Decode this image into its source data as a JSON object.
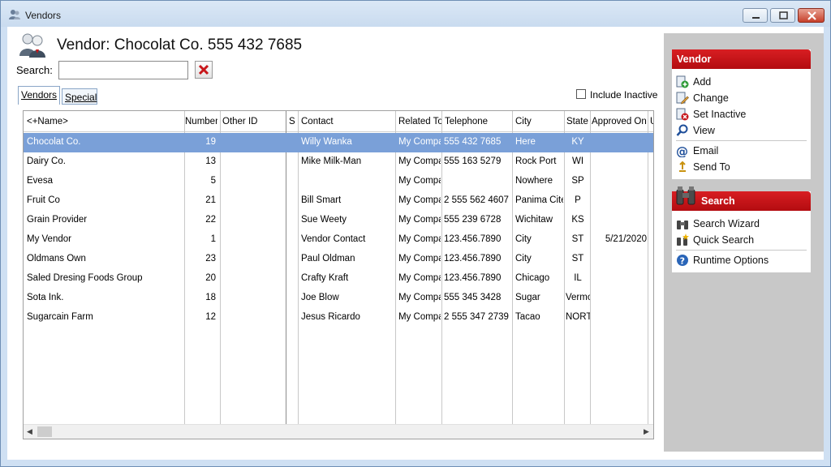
{
  "window": {
    "title": "Vendors"
  },
  "header": {
    "title": "Vendor: Chocolat Co. 555 432 7685"
  },
  "search": {
    "label": "Search:",
    "value": ""
  },
  "tabs": [
    {
      "label": "Vendors"
    },
    {
      "label": "Special"
    }
  ],
  "include_inactive": {
    "label": "Include Inactive",
    "checked": false
  },
  "grid": {
    "columns": [
      "<+Name>",
      "Number",
      "Other ID",
      "S",
      "Contact",
      "Related To",
      "Telephone",
      "City",
      "State",
      "Approved On",
      "U"
    ],
    "rows": [
      {
        "name": "Chocolat Co.",
        "number": "19",
        "other_id": "",
        "s": "",
        "contact": "Willy Wanka",
        "related": "My Company",
        "phone": "555 432 7685",
        "city": "Here",
        "state": "KY",
        "approved": ""
      },
      {
        "name": "Dairy Co.",
        "number": "13",
        "other_id": "",
        "s": "",
        "contact": "Mike Milk-Man",
        "related": "My Company",
        "phone": "555 163 5279",
        "city": "Rock Port",
        "state": "WI",
        "approved": ""
      },
      {
        "name": "Evesa",
        "number": "5",
        "other_id": "",
        "s": "",
        "contact": "",
        "related": "My Company",
        "phone": "",
        "city": "Nowhere",
        "state": "SP",
        "approved": ""
      },
      {
        "name": "Fruit Co",
        "number": "21",
        "other_id": "",
        "s": "",
        "contact": "Bill Smart",
        "related": "My Company",
        "phone": "2 555 562 4607",
        "city": "Panima Cite",
        "state": "P",
        "approved": ""
      },
      {
        "name": "Grain Provider",
        "number": "22",
        "other_id": "",
        "s": "",
        "contact": "Sue Weety",
        "related": "My Company",
        "phone": "555 239 6728",
        "city": "Wichitaw",
        "state": "KS",
        "approved": ""
      },
      {
        "name": "My Vendor",
        "number": "1",
        "other_id": "",
        "s": "",
        "contact": "Vendor Contact",
        "related": "My Company",
        "phone": "123.456.7890",
        "city": "City",
        "state": "ST",
        "approved": "5/21/2020"
      },
      {
        "name": "Oldmans Own",
        "number": "23",
        "other_id": "",
        "s": "",
        "contact": "Paul Oldman",
        "related": "My Company",
        "phone": "123.456.7890",
        "city": "City",
        "state": "ST",
        "approved": ""
      },
      {
        "name": "Saled Dresing Foods Group",
        "number": "20",
        "other_id": "",
        "s": "",
        "contact": "Crafty Kraft",
        "related": "My Company",
        "phone": "123.456.7890",
        "city": "Chicago",
        "state": "IL",
        "approved": ""
      },
      {
        "name": "Sota Ink.",
        "number": "18",
        "other_id": "",
        "s": "",
        "contact": "Joe Blow",
        "related": "My Company",
        "phone": "555 345 3428",
        "city": "Sugar",
        "state": "Vermont",
        "approved": ""
      },
      {
        "name": "Sugarcain Farm",
        "number": "12",
        "other_id": "",
        "s": "",
        "contact": "Jesus Ricardo",
        "related": "My Company",
        "phone": "2 555 347 2739",
        "city": "Tacao",
        "state": "NORTH",
        "approved": ""
      }
    ]
  },
  "sidepanel": {
    "vendor": {
      "title": "Vendor",
      "items": [
        {
          "label": "Add",
          "icon": "add-icon"
        },
        {
          "label": "Change",
          "icon": "edit-icon"
        },
        {
          "label": "Set Inactive",
          "icon": "set-inactive-icon"
        },
        {
          "label": "View",
          "icon": "magnifier-icon"
        },
        {
          "label": "Email",
          "icon": "at-sign-icon"
        },
        {
          "label": "Send To",
          "icon": "send-to-icon"
        }
      ]
    },
    "search": {
      "title": "Search",
      "items": [
        {
          "label": "Search Wizard",
          "icon": "binoculars-icon"
        },
        {
          "label": "Quick Search",
          "icon": "quick-search-icon"
        },
        {
          "label": "Runtime Options",
          "icon": "help-icon"
        }
      ]
    }
  },
  "colors": {
    "accent_red": "#c8161a",
    "selection_blue": "#7aa0d8",
    "panel_gray": "#c8c8c8"
  }
}
